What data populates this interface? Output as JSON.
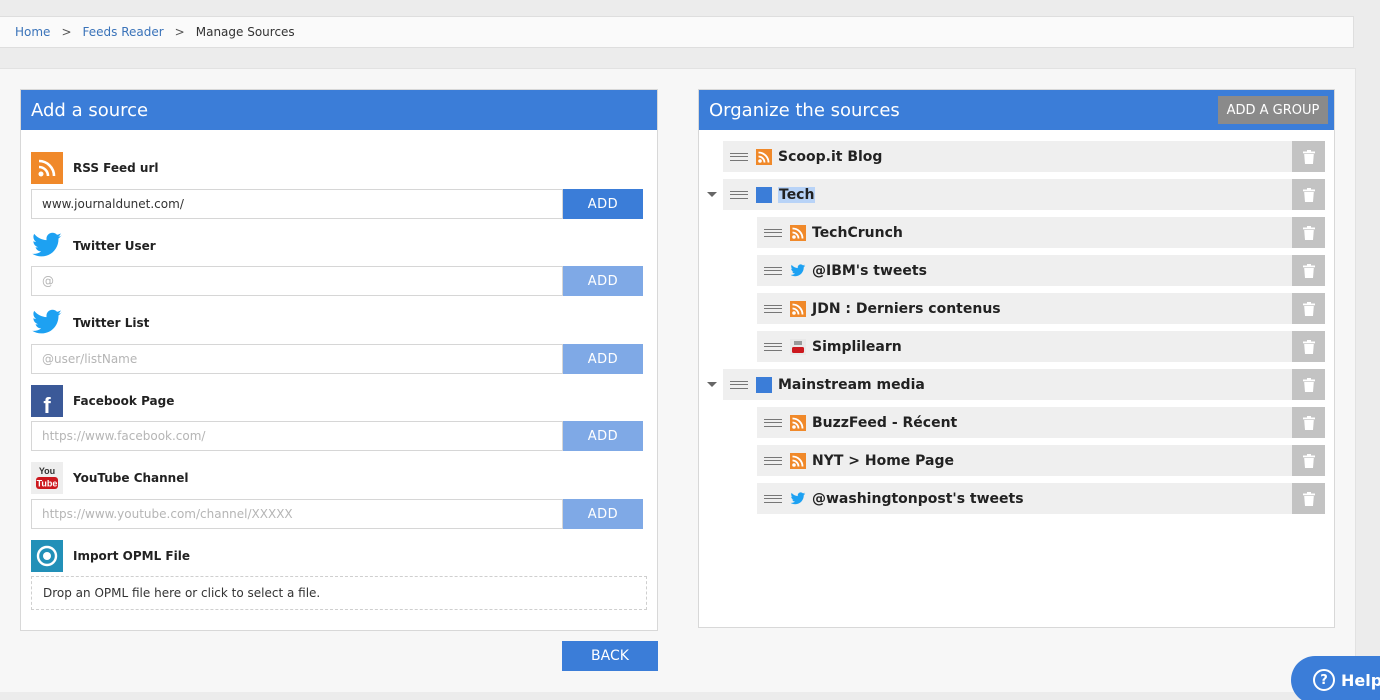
{
  "breadcrumb": {
    "home": "Home",
    "feeds": "Feeds Reader",
    "current": "Manage Sources",
    "separator": ">"
  },
  "add_source": {
    "title": "Add a source",
    "add_label": "ADD",
    "rss": {
      "label": "RSS Feed url",
      "value": "www.journaldunet.com/",
      "icon": "rss-icon"
    },
    "twitter_user": {
      "label": "Twitter User",
      "placeholder": "@",
      "icon": "twitter-bird-icon"
    },
    "twitter_list": {
      "label": "Twitter List",
      "placeholder": "@user/listName",
      "icon": "twitter-bird-icon"
    },
    "facebook": {
      "label": "Facebook Page",
      "placeholder": "https://www.facebook.com/",
      "icon": "facebook-icon"
    },
    "youtube": {
      "label": "YouTube Channel",
      "placeholder": "https://www.youtube.com/channel/XXXXX",
      "icon": "youtube-icon"
    },
    "opml": {
      "label": "Import OPML File",
      "drop_text": "Drop an OPML file here or click to select a file.",
      "icon": "opml-icon"
    },
    "back_label": "BACK"
  },
  "organize": {
    "title": "Organize the sources",
    "add_group_label": "ADD A GROUP",
    "rows": [
      {
        "label": "Scoop.it Blog",
        "type": "rss"
      },
      {
        "label": "Tech",
        "type": "group",
        "selected": true
      },
      {
        "label": "TechCrunch",
        "type": "rss"
      },
      {
        "label": "@IBM's tweets",
        "type": "twitter"
      },
      {
        "label": "JDN : Derniers contenus",
        "type": "rss"
      },
      {
        "label": "Simplilearn",
        "type": "youtube"
      },
      {
        "label": "Mainstream media",
        "type": "group"
      },
      {
        "label": "BuzzFeed - Récent",
        "type": "rss"
      },
      {
        "label": "NYT > Home Page",
        "type": "rss"
      },
      {
        "label": "@washingtonpost's tweets",
        "type": "twitter"
      }
    ]
  },
  "help": {
    "label": "Help",
    "glyph": "?"
  },
  "colors": {
    "accent": "#3b7dd8",
    "rss": "#f0892a",
    "twitter": "#1da1f2",
    "facebook": "#3b5998",
    "youtube": "#cc181e",
    "opml": "#2290b8"
  }
}
